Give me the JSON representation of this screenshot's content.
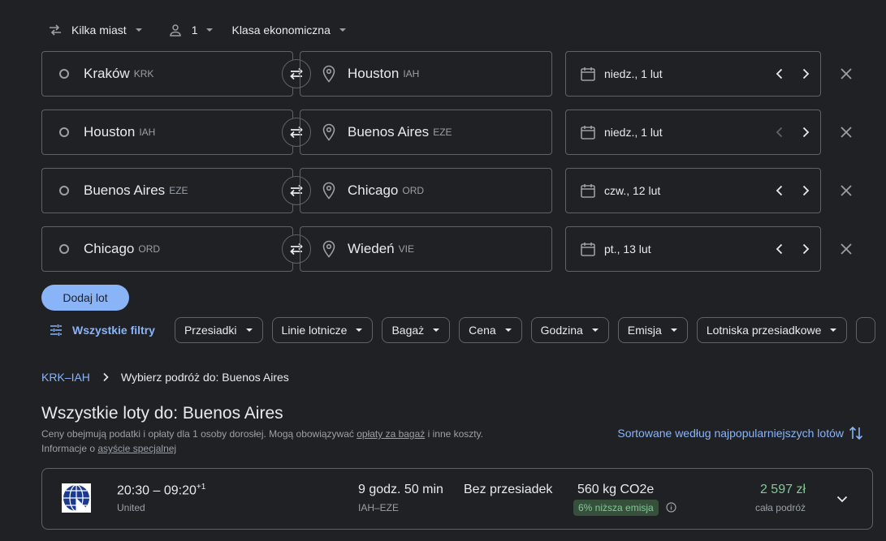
{
  "topbar": {
    "trip_type": "Kilka miast",
    "passengers": "1",
    "cabin": "Klasa ekonomiczna"
  },
  "legs": [
    {
      "origin_city": "Kraków",
      "origin_code": "KRK",
      "dest_city": "Houston",
      "dest_code": "IAH",
      "date": "niedz., 1 lut"
    },
    {
      "origin_city": "Houston",
      "origin_code": "IAH",
      "dest_city": "Buenos Aires",
      "dest_code": "EZE",
      "date": "niedz., 1 lut"
    },
    {
      "origin_city": "Buenos Aires",
      "origin_code": "EZE",
      "dest_city": "Chicago",
      "dest_code": "ORD",
      "date": "czw., 12 lut"
    },
    {
      "origin_city": "Chicago",
      "origin_code": "ORD",
      "dest_city": "Wiedeń",
      "dest_code": "VIE",
      "date": "pt., 13 lut"
    }
  ],
  "add_flight_label": "Dodaj lot",
  "filters": {
    "all_label": "Wszystkie filtry",
    "chips": [
      "Przesiadki",
      "Linie lotnicze",
      "Bagaż",
      "Cena",
      "Godzina",
      "Emisja",
      "Lotniska przesiadkowe"
    ]
  },
  "breadcrumb": {
    "link": "KRK–IAH",
    "current": "Wybierz podróż do: Buenos Aires"
  },
  "results": {
    "title": "Wszystkie loty do: Buenos Aires",
    "note_1": "Ceny obejmują podatki i opłaty dla 1 osoby dorosłej. Mogą obowiązywać ",
    "note_link_1": "opłaty za bagaż",
    "note_2": " i inne koszty.",
    "note_3": "Informacje o ",
    "note_link_2": "asyście specjalnej",
    "sort_label": "Sortowane według najpopularniejszych lotów"
  },
  "flight": {
    "times": "20:30 – 09:20",
    "day_offset": "+1",
    "airline": "United",
    "duration": "9 godz. 50 min",
    "route": "IAH–EZE",
    "stops": "Bez przesiadek",
    "co2": "560 kg CO2e",
    "emission_badge": "6% niższa emisja",
    "price": "2 597 zł",
    "price_note": "cała podróż"
  },
  "colors": {
    "background": "#202124",
    "accent": "#8ab4f8",
    "price_green": "#81c995",
    "border": "#5f6368"
  }
}
